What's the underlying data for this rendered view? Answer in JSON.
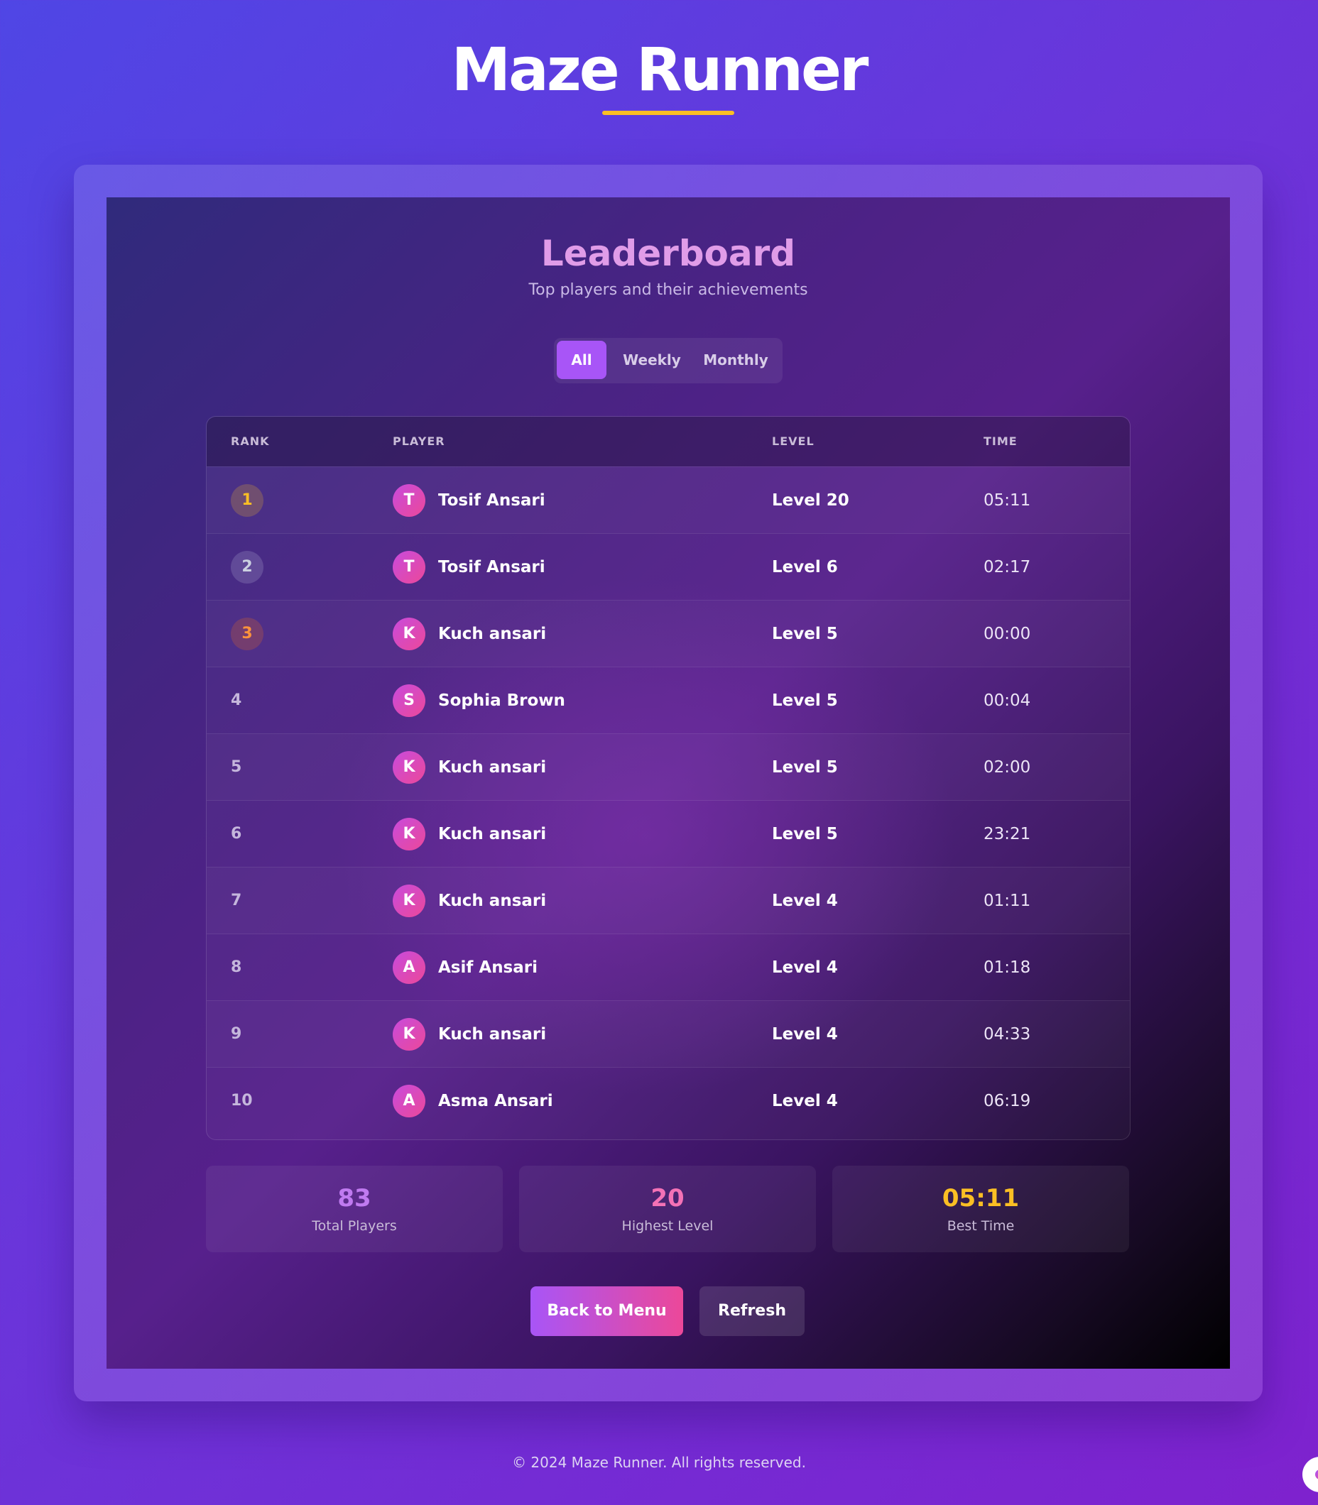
{
  "app": {
    "title": "Maze Runner",
    "accent_color": "#fbbf24"
  },
  "leaderboard": {
    "title": "Leaderboard",
    "subtitle": "Top players and their achievements",
    "tabs": [
      {
        "label": "All",
        "active": true
      },
      {
        "label": "Weekly",
        "active": false
      },
      {
        "label": "Monthly",
        "active": false
      }
    ],
    "columns": {
      "rank": "RANK",
      "player": "PLAYER",
      "level": "LEVEL",
      "time": "TIME"
    },
    "rows": [
      {
        "rank": "1",
        "initial": "T",
        "name": "Tosif Ansari",
        "level": "Level 20",
        "time": "05:11"
      },
      {
        "rank": "2",
        "initial": "T",
        "name": "Tosif Ansari",
        "level": "Level 6",
        "time": "02:17"
      },
      {
        "rank": "3",
        "initial": "K",
        "name": "Kuch ansari",
        "level": "Level 5",
        "time": "00:00"
      },
      {
        "rank": "4",
        "initial": "S",
        "name": "Sophia Brown",
        "level": "Level 5",
        "time": "00:04"
      },
      {
        "rank": "5",
        "initial": "K",
        "name": "Kuch ansari",
        "level": "Level 5",
        "time": "02:00"
      },
      {
        "rank": "6",
        "initial": "K",
        "name": "Kuch ansari",
        "level": "Level 5",
        "time": "23:21"
      },
      {
        "rank": "7",
        "initial": "K",
        "name": "Kuch ansari",
        "level": "Level 4",
        "time": "01:11"
      },
      {
        "rank": "8",
        "initial": "A",
        "name": "Asif Ansari",
        "level": "Level 4",
        "time": "01:18"
      },
      {
        "rank": "9",
        "initial": "K",
        "name": "Kuch ansari",
        "level": "Level 4",
        "time": "04:33"
      },
      {
        "rank": "10",
        "initial": "A",
        "name": "Asma Ansari",
        "level": "Level 4",
        "time": "06:19"
      }
    ]
  },
  "stats": [
    {
      "value": "83",
      "label": "Total Players",
      "color": "#c07af0"
    },
    {
      "value": "20",
      "label": "Highest Level",
      "color": "#f472b6"
    },
    {
      "value": "05:11",
      "label": "Best Time",
      "color": "#fbbf24"
    }
  ],
  "buttons": {
    "back_label": "Back to Menu",
    "refresh_label": "Refresh"
  },
  "footer": {
    "copyright": "© 2024 Maze Runner. All rights reserved."
  }
}
